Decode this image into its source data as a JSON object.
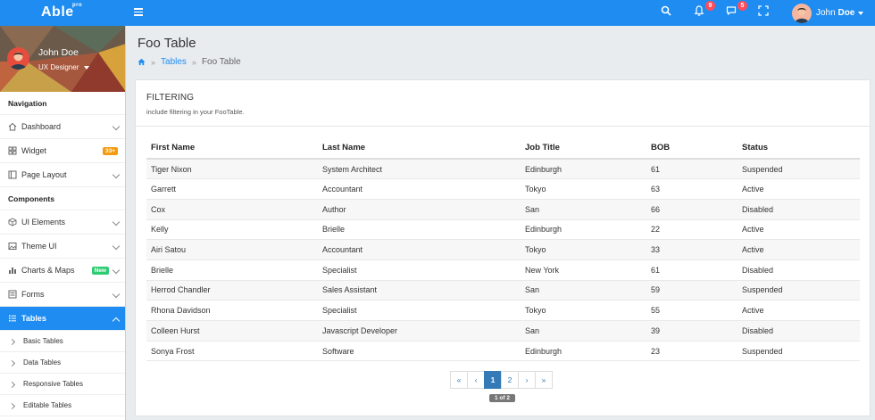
{
  "topbar": {
    "logo": "Able",
    "logo_sup": "pro",
    "notifications_count": "9",
    "messages_count": "5",
    "user_first": "John",
    "user_last": "Doe"
  },
  "sidebar": {
    "profile": {
      "name": "John Doe",
      "role": "UX Designer"
    },
    "sections": [
      {
        "title": "Navigation"
      },
      {
        "title": "Components"
      }
    ],
    "nav_items": [
      {
        "label": "Dashboard",
        "icon": "home-icon"
      },
      {
        "label": "Widget",
        "icon": "grid-icon",
        "tag": "33+"
      },
      {
        "label": "Page Layout",
        "icon": "layout-icon"
      },
      {
        "label": "UI Elements",
        "icon": "box-icon"
      },
      {
        "label": "Theme UI",
        "icon": "image-icon"
      },
      {
        "label": "Charts & Maps",
        "icon": "chart-icon",
        "tag": "New"
      },
      {
        "label": "Forms",
        "icon": "form-icon"
      },
      {
        "label": "Tables",
        "icon": "list-icon",
        "active": true
      }
    ],
    "sub_items": [
      {
        "label": "Basic Tables"
      },
      {
        "label": "Data Tables"
      },
      {
        "label": "Responsive Tables"
      },
      {
        "label": "Editable Tables"
      }
    ]
  },
  "main": {
    "title": "Foo Table",
    "breadcrumb": {
      "link": "Tables",
      "current": "Foo Table"
    },
    "card": {
      "title": "FILTERING",
      "subtitle": "include filtering in your FooTable."
    },
    "table": {
      "headers": [
        "First Name",
        "Last Name",
        "Job Title",
        "BOB",
        "Status"
      ],
      "rows": [
        [
          "Tiger Nixon",
          "System Architect",
          "Edinburgh",
          "61",
          "Suspended"
        ],
        [
          "Garrett",
          "Accountant",
          "Tokyo",
          "63",
          "Active"
        ],
        [
          "Cox",
          "Author",
          "San",
          "66",
          "Disabled"
        ],
        [
          "Kelly",
          "Brielle",
          "Edinburgh",
          "22",
          "Active"
        ],
        [
          "Airi Satou",
          "Accountant",
          "Tokyo",
          "33",
          "Active"
        ],
        [
          "Brielle",
          "Specialist",
          "New York",
          "61",
          "Disabled"
        ],
        [
          "Herrod Chandler",
          "Sales Assistant",
          "San",
          "59",
          "Suspended"
        ],
        [
          "Rhona Davidson",
          "Specialist",
          "Tokyo",
          "55",
          "Active"
        ],
        [
          "Colleen Hurst",
          "Javascript Developer",
          "San",
          "39",
          "Disabled"
        ],
        [
          "Sonya Frost",
          "Software",
          "Edinburgh",
          "23",
          "Suspended"
        ]
      ]
    },
    "pagination": {
      "buttons": [
        "«",
        "‹",
        "1",
        "2",
        "›",
        "»"
      ],
      "current": "1",
      "info": "1 of 2"
    }
  },
  "colors": {
    "primary": "#1e8cf0",
    "badge": "#ff4d5c",
    "pager_active": "#337ab7"
  }
}
